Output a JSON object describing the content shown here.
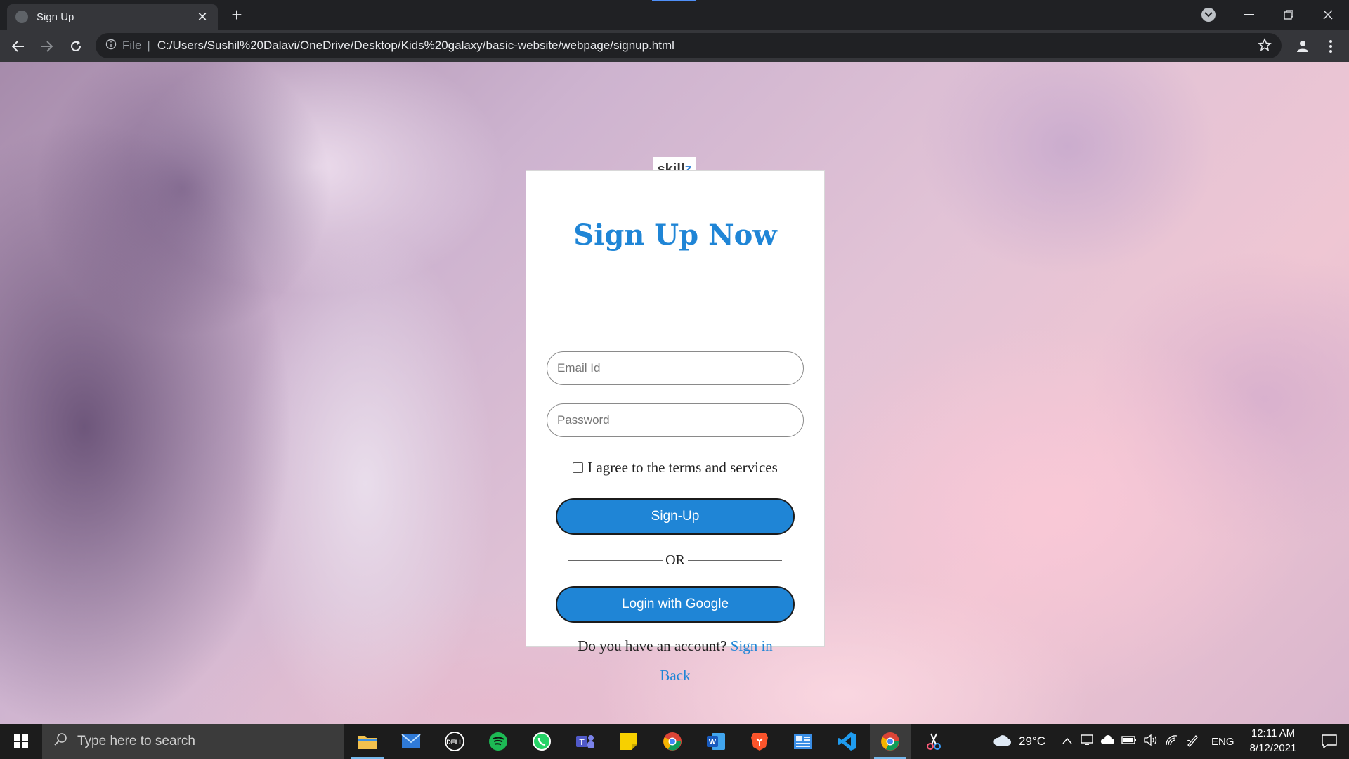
{
  "browser": {
    "tab_title": "Sign Up",
    "tab_close": "✕",
    "new_tab": "+",
    "file_label": "File",
    "address": "C:/Users/Sushil%20Dalavi/OneDrive/Desktop/Kids%20galaxy/basic-website/webpage/signup.html"
  },
  "page": {
    "logo_main": "skill",
    "logo_accent": "z",
    "title": "Sign Up Now",
    "email_placeholder": "Email Id",
    "password_placeholder": "Password",
    "agree_text": "I agree to the terms and services",
    "signup_button": "Sign-Up",
    "or_text": "OR",
    "google_button": "Login with Google",
    "account_question": "Do you have an account?",
    "signin_link": "Sign in",
    "back_link": "Back",
    "colors": {
      "accent": "#1f85d6",
      "logo_accent": "#3a86d6"
    }
  },
  "taskbar": {
    "search_placeholder": "Type here to search",
    "weather_temp": "29°C",
    "language": "ENG",
    "time": "12:11 AM",
    "date": "8/12/2021",
    "icons": [
      "file-explorer-icon",
      "mail-icon",
      "dell-icon",
      "spotify-icon",
      "whatsapp-icon",
      "teams-icon",
      "sticky-notes-icon",
      "chrome-icon",
      "word-icon",
      "brave-icon",
      "news-icon",
      "vscode-icon",
      "chrome-icon",
      "snip-icon"
    ]
  }
}
